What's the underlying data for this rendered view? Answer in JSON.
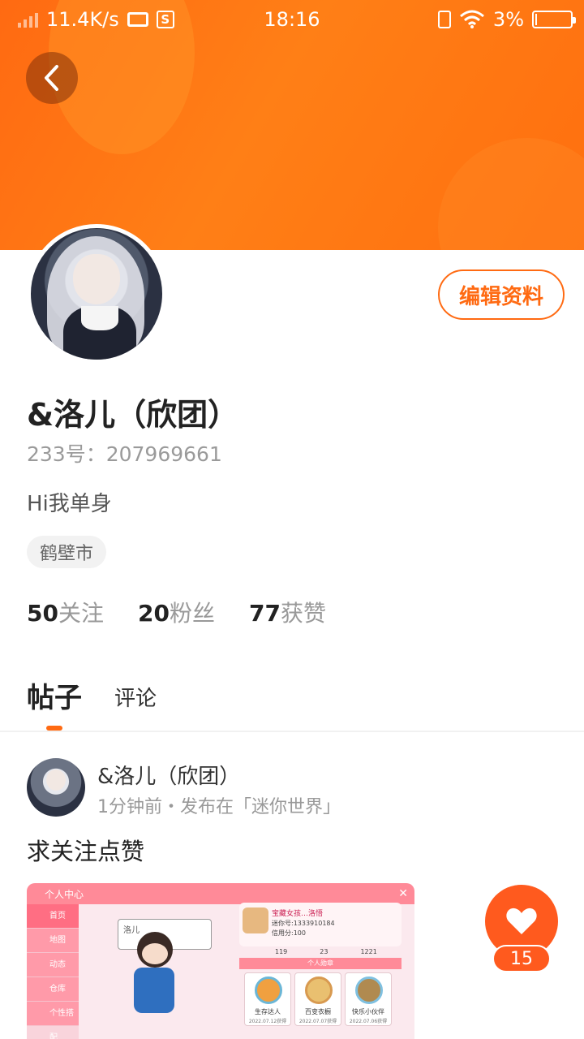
{
  "status_bar": {
    "net_speed": "11.4K/s",
    "time": "18:16",
    "battery_pct": "3%",
    "battery_level": 0.03
  },
  "profile": {
    "edit_label": "编辑资料",
    "name": "&洛儿（欣团）",
    "id_line": "233号：207969661",
    "bio": "Hi我单身",
    "city": "鹤壁市",
    "stats": {
      "follow_num": "50",
      "follow_label": "关注",
      "fans_num": "20",
      "fans_label": "粉丝",
      "likes_num": "77",
      "likes_label": "获赞"
    }
  },
  "tabs": {
    "posts": "帖子",
    "comments": "评论"
  },
  "post": {
    "author": "&洛儿（欣团）",
    "meta": "1分钟前・发布在「迷你世界」",
    "text": "求关注点赞",
    "like_count": "15"
  },
  "screenshot": {
    "title": "个人中心",
    "side_items": [
      "首页",
      "地图",
      "动态",
      "仓库",
      "个性搭配"
    ],
    "name_box": "洛儿",
    "card_line1": "宝藏女孩…洛悟",
    "card_line2": "迷你号:1333910184",
    "card_line3": "信用分:100",
    "stat_a": "119",
    "stat_b": "23",
    "stat_c": "1221",
    "medal_header": "个人勋章",
    "medals": [
      {
        "title": "生存达人",
        "date": "2022.07.12获得"
      },
      {
        "title": "百变衣橱",
        "date": "2022.07.07获得"
      },
      {
        "title": "快乐小伙伴",
        "date": "2022.07.06获得"
      }
    ]
  },
  "colors": {
    "accent": "#ff6a12",
    "like": "#ff5a1e"
  }
}
